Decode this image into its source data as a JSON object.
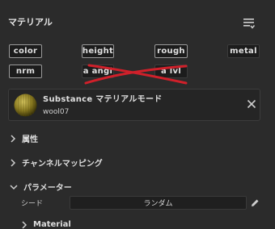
{
  "panel": {
    "title": "マテリアル",
    "menu_icon": "list-settings-icon"
  },
  "channels": {
    "row1": [
      "color",
      "height",
      "rough",
      "metal"
    ],
    "row2": [
      "nrm",
      "a angl",
      "a lvl"
    ],
    "strike_color": "#d0202a"
  },
  "material": {
    "name": "Substance マテリアルモード",
    "file": "wool07",
    "thumbnail_icon": "wool-ball-icon",
    "close_icon": "close-icon"
  },
  "sections": {
    "attributes": "属性",
    "channel_mapping": "チャンネルマッピング",
    "parameters": "パラメーター",
    "material": "Material"
  },
  "seed": {
    "label": "シード",
    "value": "ランダム",
    "edit_icon": "pencil-icon"
  }
}
